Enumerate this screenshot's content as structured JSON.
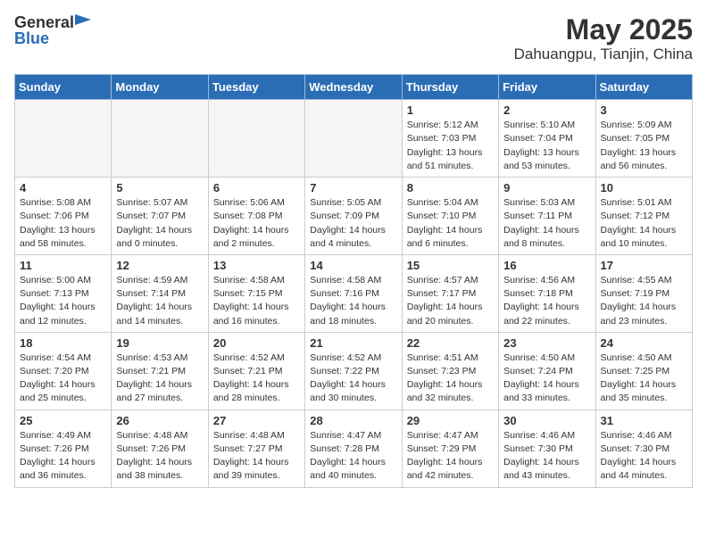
{
  "header": {
    "logo_general": "General",
    "logo_blue": "Blue",
    "title": "May 2025",
    "subtitle": "Dahuangpu, Tianjin, China"
  },
  "weekdays": [
    "Sunday",
    "Monday",
    "Tuesday",
    "Wednesday",
    "Thursday",
    "Friday",
    "Saturday"
  ],
  "weeks": [
    [
      {
        "day": "",
        "info": ""
      },
      {
        "day": "",
        "info": ""
      },
      {
        "day": "",
        "info": ""
      },
      {
        "day": "",
        "info": ""
      },
      {
        "day": "1",
        "info": "Sunrise: 5:12 AM\nSunset: 7:03 PM\nDaylight: 13 hours\nand 51 minutes."
      },
      {
        "day": "2",
        "info": "Sunrise: 5:10 AM\nSunset: 7:04 PM\nDaylight: 13 hours\nand 53 minutes."
      },
      {
        "day": "3",
        "info": "Sunrise: 5:09 AM\nSunset: 7:05 PM\nDaylight: 13 hours\nand 56 minutes."
      }
    ],
    [
      {
        "day": "4",
        "info": "Sunrise: 5:08 AM\nSunset: 7:06 PM\nDaylight: 13 hours\nand 58 minutes."
      },
      {
        "day": "5",
        "info": "Sunrise: 5:07 AM\nSunset: 7:07 PM\nDaylight: 14 hours\nand 0 minutes."
      },
      {
        "day": "6",
        "info": "Sunrise: 5:06 AM\nSunset: 7:08 PM\nDaylight: 14 hours\nand 2 minutes."
      },
      {
        "day": "7",
        "info": "Sunrise: 5:05 AM\nSunset: 7:09 PM\nDaylight: 14 hours\nand 4 minutes."
      },
      {
        "day": "8",
        "info": "Sunrise: 5:04 AM\nSunset: 7:10 PM\nDaylight: 14 hours\nand 6 minutes."
      },
      {
        "day": "9",
        "info": "Sunrise: 5:03 AM\nSunset: 7:11 PM\nDaylight: 14 hours\nand 8 minutes."
      },
      {
        "day": "10",
        "info": "Sunrise: 5:01 AM\nSunset: 7:12 PM\nDaylight: 14 hours\nand 10 minutes."
      }
    ],
    [
      {
        "day": "11",
        "info": "Sunrise: 5:00 AM\nSunset: 7:13 PM\nDaylight: 14 hours\nand 12 minutes."
      },
      {
        "day": "12",
        "info": "Sunrise: 4:59 AM\nSunset: 7:14 PM\nDaylight: 14 hours\nand 14 minutes."
      },
      {
        "day": "13",
        "info": "Sunrise: 4:58 AM\nSunset: 7:15 PM\nDaylight: 14 hours\nand 16 minutes."
      },
      {
        "day": "14",
        "info": "Sunrise: 4:58 AM\nSunset: 7:16 PM\nDaylight: 14 hours\nand 18 minutes."
      },
      {
        "day": "15",
        "info": "Sunrise: 4:57 AM\nSunset: 7:17 PM\nDaylight: 14 hours\nand 20 minutes."
      },
      {
        "day": "16",
        "info": "Sunrise: 4:56 AM\nSunset: 7:18 PM\nDaylight: 14 hours\nand 22 minutes."
      },
      {
        "day": "17",
        "info": "Sunrise: 4:55 AM\nSunset: 7:19 PM\nDaylight: 14 hours\nand 23 minutes."
      }
    ],
    [
      {
        "day": "18",
        "info": "Sunrise: 4:54 AM\nSunset: 7:20 PM\nDaylight: 14 hours\nand 25 minutes."
      },
      {
        "day": "19",
        "info": "Sunrise: 4:53 AM\nSunset: 7:21 PM\nDaylight: 14 hours\nand 27 minutes."
      },
      {
        "day": "20",
        "info": "Sunrise: 4:52 AM\nSunset: 7:21 PM\nDaylight: 14 hours\nand 28 minutes."
      },
      {
        "day": "21",
        "info": "Sunrise: 4:52 AM\nSunset: 7:22 PM\nDaylight: 14 hours\nand 30 minutes."
      },
      {
        "day": "22",
        "info": "Sunrise: 4:51 AM\nSunset: 7:23 PM\nDaylight: 14 hours\nand 32 minutes."
      },
      {
        "day": "23",
        "info": "Sunrise: 4:50 AM\nSunset: 7:24 PM\nDaylight: 14 hours\nand 33 minutes."
      },
      {
        "day": "24",
        "info": "Sunrise: 4:50 AM\nSunset: 7:25 PM\nDaylight: 14 hours\nand 35 minutes."
      }
    ],
    [
      {
        "day": "25",
        "info": "Sunrise: 4:49 AM\nSunset: 7:26 PM\nDaylight: 14 hours\nand 36 minutes."
      },
      {
        "day": "26",
        "info": "Sunrise: 4:48 AM\nSunset: 7:26 PM\nDaylight: 14 hours\nand 38 minutes."
      },
      {
        "day": "27",
        "info": "Sunrise: 4:48 AM\nSunset: 7:27 PM\nDaylight: 14 hours\nand 39 minutes."
      },
      {
        "day": "28",
        "info": "Sunrise: 4:47 AM\nSunset: 7:28 PM\nDaylight: 14 hours\nand 40 minutes."
      },
      {
        "day": "29",
        "info": "Sunrise: 4:47 AM\nSunset: 7:29 PM\nDaylight: 14 hours\nand 42 minutes."
      },
      {
        "day": "30",
        "info": "Sunrise: 4:46 AM\nSunset: 7:30 PM\nDaylight: 14 hours\nand 43 minutes."
      },
      {
        "day": "31",
        "info": "Sunrise: 4:46 AM\nSunset: 7:30 PM\nDaylight: 14 hours\nand 44 minutes."
      }
    ]
  ]
}
